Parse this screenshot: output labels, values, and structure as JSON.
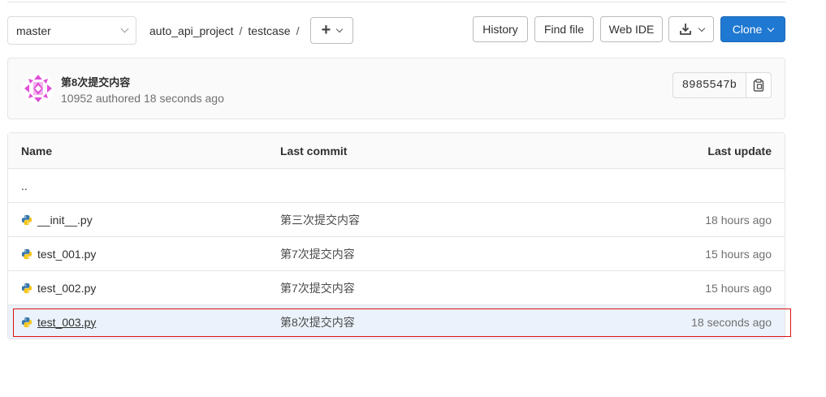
{
  "toolbar": {
    "branch": "master",
    "breadcrumb": [
      "auto_api_project",
      "testcase"
    ],
    "separator": "/",
    "add_icon": "plus-icon",
    "history_label": "History",
    "find_file_label": "Find file",
    "web_ide_label": "Web IDE",
    "download_icon": "download-icon",
    "clone_label": "Clone"
  },
  "commit": {
    "title": "第8次提交内容",
    "author": "10952",
    "authored_text": "authored",
    "time": "18 seconds ago",
    "sha": "8985547b",
    "copy_icon": "clipboard-icon"
  },
  "table": {
    "headers": {
      "name": "Name",
      "last_commit": "Last commit",
      "last_update": "Last update"
    },
    "parent": "..",
    "rows": [
      {
        "name": "__init__.py",
        "commit": "第三次提交内容",
        "update": "18 hours ago"
      },
      {
        "name": "test_001.py",
        "commit": "第7次提交内容",
        "update": "15 hours ago"
      },
      {
        "name": "test_002.py",
        "commit": "第7次提交内容",
        "update": "15 hours ago"
      },
      {
        "name": "test_003.py",
        "commit": "第8次提交内容",
        "update": "18 seconds ago"
      }
    ]
  },
  "colors": {
    "accent": "#1f78d1",
    "highlight_row": "#ebf2fb",
    "annotation": "#dd1111"
  }
}
